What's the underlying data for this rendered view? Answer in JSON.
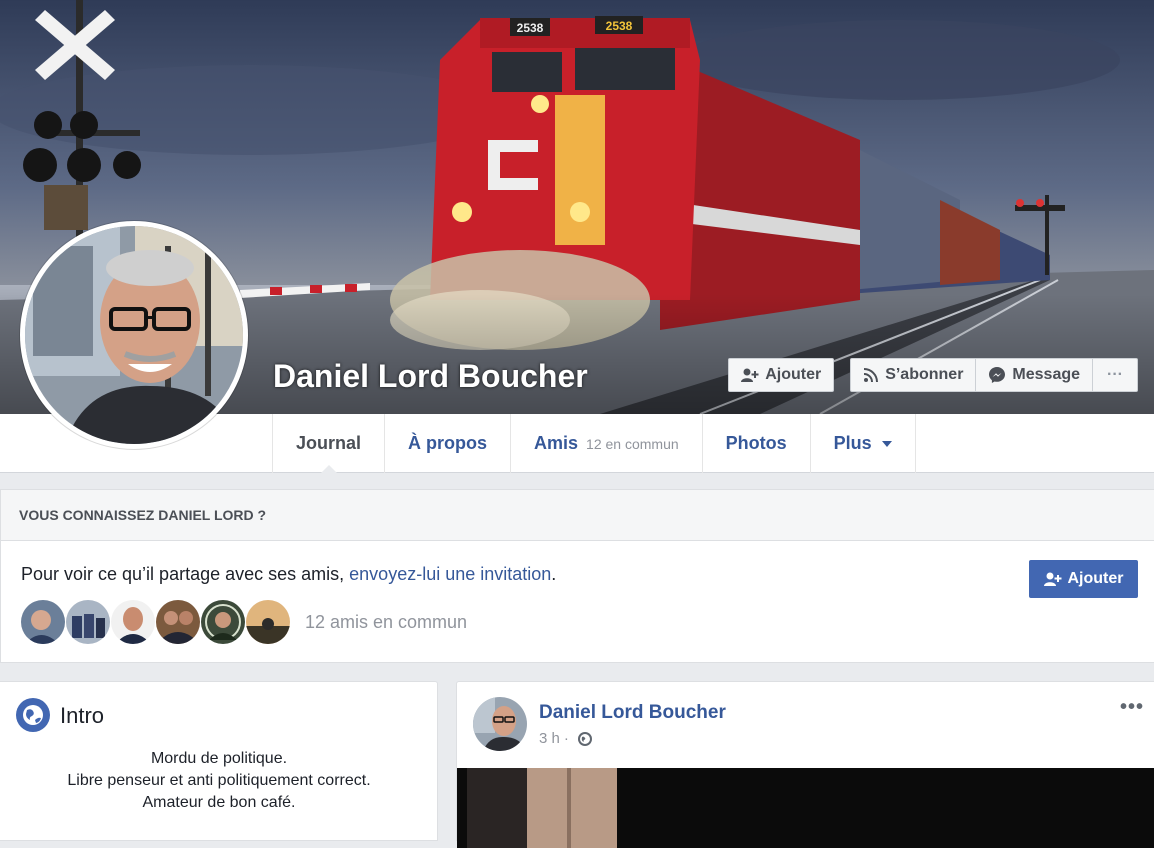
{
  "profile": {
    "name": "Daniel Lord Boucher"
  },
  "cover_actions": {
    "add_label": "Ajouter",
    "follow_label": "S’abonner",
    "message_label": "Message",
    "more_label": "···"
  },
  "tabs": [
    {
      "label": "Journal",
      "active": true
    },
    {
      "label": "À propos"
    },
    {
      "label": "Amis",
      "sub": "12 en commun"
    },
    {
      "label": "Photos"
    },
    {
      "label": "Plus"
    }
  ],
  "know_card": {
    "heading": "VOUS CONNAISSEZ DANIEL LORD ?",
    "text_prefix": "Pour voir ce qu’il partage avec ses amis, ",
    "link_text": "envoyez-lui une invitation",
    "text_suffix": ".",
    "add_label": "Ajouter",
    "mutual_count_text": "12 amis en commun"
  },
  "intro": {
    "title": "Intro",
    "lines": [
      "Mordu de politique.",
      "Libre penseur et anti politiquement correct.",
      "Amateur de bon café."
    ]
  },
  "post": {
    "author": "Daniel Lord Boucher",
    "time": "3 h",
    "separator": "·",
    "more_label": "•••"
  },
  "colors": {
    "link_blue": "#365899",
    "button_blue": "#4267b2",
    "page_bg": "#e9ebee",
    "loco_red": "#c8202a"
  },
  "icons": [
    "add-friend-icon",
    "rss-icon",
    "messenger-icon",
    "globe-icon",
    "caret-down-icon"
  ]
}
